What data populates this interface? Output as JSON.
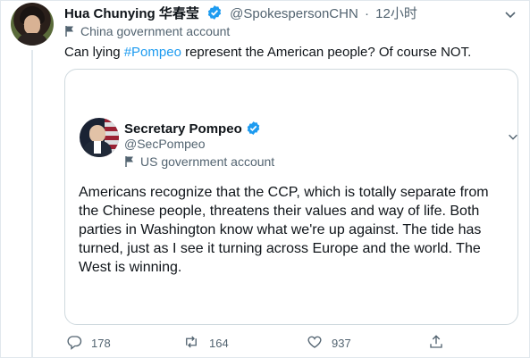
{
  "tweet": {
    "author_name": "Hua Chunying 华春莹",
    "handle": "@SpokespersonCHN",
    "separator": "·",
    "time": "12小时",
    "account_label": "China government account",
    "text_before": "Can lying ",
    "hashtag": "#Pompeo",
    "text_after": " represent the American people? Of course NOT."
  },
  "quoted": {
    "author_name": "Secretary Pompeo",
    "handle": "@SecPompeo",
    "account_label": "US government account",
    "text": "Americans recognize that the CCP, which is totally separate from the Chinese people, threatens their values and way of life. Both parties in Washington know what we're up against. The tide has turned, just as I see it turning across Europe and the world. The West is winning."
  },
  "actions": {
    "replies": "178",
    "retweets": "164",
    "likes": "937"
  },
  "colors": {
    "accent": "#1d9bf0",
    "secondary_text": "#536471",
    "border": "#cfd9de"
  },
  "icons": [
    "verified-badge-icon",
    "flag-icon",
    "chevron-down-icon",
    "reply-icon",
    "retweet-icon",
    "like-icon",
    "share-icon"
  ]
}
